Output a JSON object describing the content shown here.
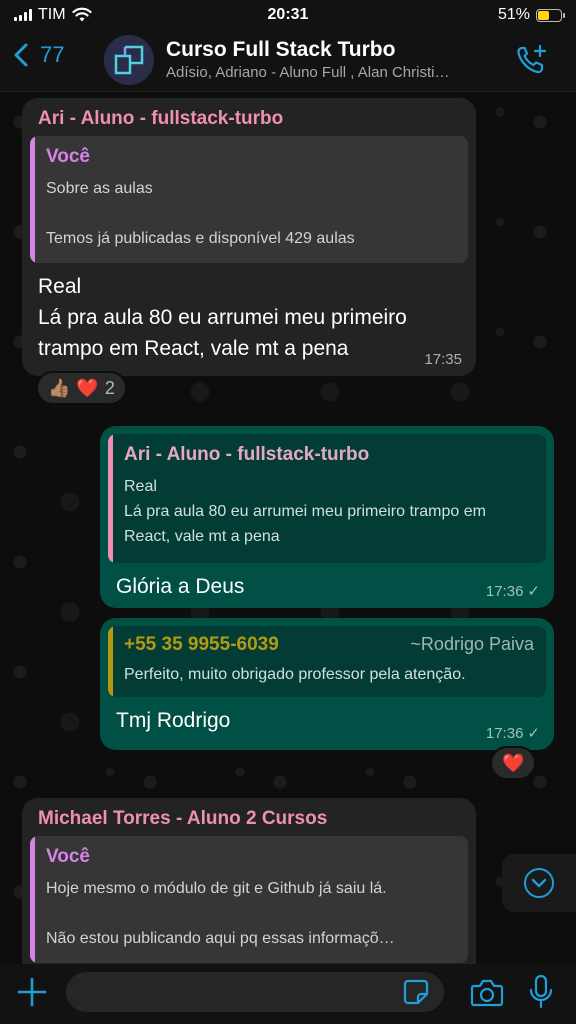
{
  "status_bar": {
    "carrier": "TIM",
    "time": "20:31",
    "battery_percent": "51%",
    "battery_level": 0.51,
    "battery_color": "#ffd60a"
  },
  "header": {
    "back_count": "77",
    "title": "Curso Full Stack Turbo",
    "members": "Adísio, Adriano - Aluno Full , Alan Christi…",
    "call_icon": "add-call-icon",
    "accent_color": "#1e9fd8"
  },
  "messages": [
    {
      "direction": "incoming",
      "sender": "Ari - Aluno - fullstack-turbo",
      "quote": {
        "name": "Você",
        "text": "Sobre as aulas\n\nTemos já publicadas e disponível 429 aulas"
      },
      "text": "Real\nLá pra aula 80 eu arrumei meu primeiro trampo em React, vale mt a pena",
      "time": "17:35",
      "reactions": {
        "emojis": [
          "👍🏽",
          "❤️"
        ],
        "count": "2"
      }
    },
    {
      "direction": "outgoing",
      "quote": {
        "name": "Ari - Aluno - fullstack-turbo",
        "text": "Real\nLá pra aula 80 eu arrumei meu primeiro trampo em React, vale mt a pena"
      },
      "text": "Glória a Deus",
      "time": "17:36",
      "status": "✓"
    },
    {
      "direction": "outgoing",
      "quote": {
        "phone": "+55 35 9955-6039",
        "push_name": "~Rodrigo Paiva",
        "text": "Perfeito, muito obrigado professor pela atenção."
      },
      "text": "Tmj Rodrigo",
      "time": "17:36",
      "status": "✓",
      "reactions": {
        "emojis": [
          "❤️"
        ]
      }
    },
    {
      "direction": "incoming",
      "sender": "Michael Torres - Aluno 2 Cursos",
      "quote": {
        "name": "Você",
        "text": "Hoje mesmo o módulo de git e Github já saiu lá.\n\nNão estou publicando aqui pq essas informaçõ…"
      }
    }
  ],
  "input_bar": {
    "placeholder": "",
    "icons": [
      "plus-icon",
      "sticker-icon",
      "camera-icon",
      "microphone-icon"
    ]
  },
  "colors": {
    "incoming_bubble": "#232323",
    "outgoing_bubble": "#005046",
    "sender_name": "#ef8fb3",
    "self_quote": "#d683e6",
    "contact_quote": "#b49a10"
  }
}
